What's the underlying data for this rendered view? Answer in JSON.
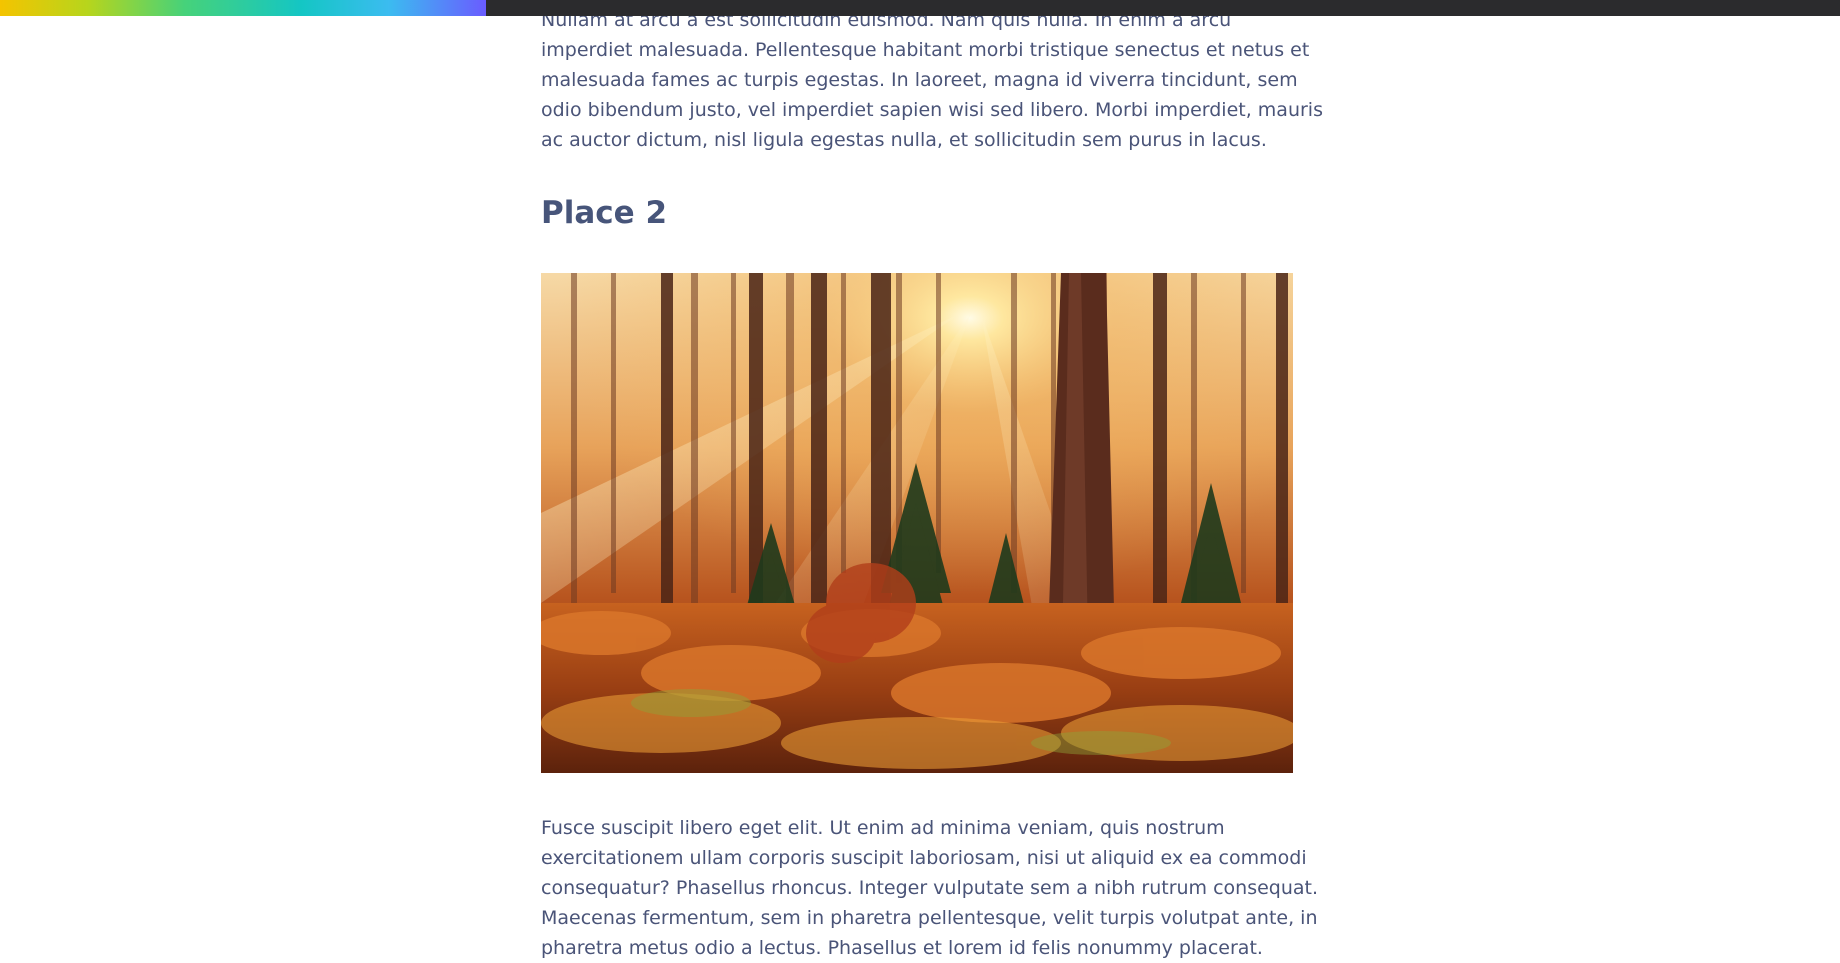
{
  "reading_progress": {
    "percent": 26.4,
    "colors": [
      "#f4c400",
      "#b7d51c",
      "#46d27a",
      "#14c6c4",
      "#3bbcf0",
      "#6a5cff"
    ],
    "track_color": "#2b2b2d"
  },
  "article": {
    "paragraph_top_lines": [
      "Nullam at arcu a est sollicitudin euismod. Nam quis nulla. In enim a arcu",
      "imperdiet malesuada. Pellentesque habitant morbi tristique senectus et netus et",
      "malesuada fames ac turpis egestas. In laoreet, magna id viverra tincidunt, sem",
      "odio bibendum justo, vel imperdiet sapien wisi sed libero. Morbi imperdiet, mauris",
      "ac auctor dictum, nisl ligula egestas nulla, et sollicitudin sem purus in lacus."
    ],
    "section_heading": "Place 2",
    "photo_subject": "sunlit autumn forest",
    "paragraph_bottom_lines": [
      "Fusce suscipit libero eget elit. Ut enim ad minima veniam, quis nostrum",
      "exercitationem ullam corporis suscipit laboriosam, nisi ut aliquid ex ea commodi",
      "consequatur? Phasellus rhoncus. Integer vulputate sem a nibh rutrum consequat.",
      "Maecenas fermentum, sem in pharetra pellentesque, velit turpis volutpat ante, in",
      "pharetra metus odio a lectus. Phasellus et lorem id felis nonummy placerat."
    ],
    "text_color": "#4a5478",
    "heading_color": "#47557a"
  }
}
